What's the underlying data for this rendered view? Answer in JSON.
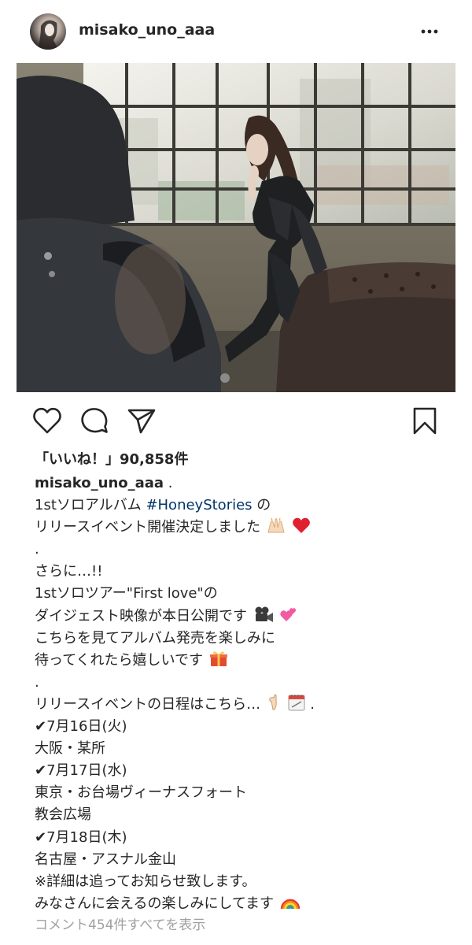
{
  "post": {
    "username": "misako_uno_aaa",
    "likes_text": "「いいね！」90,858件",
    "view_comments_text": "コメント454件すべてを表示"
  },
  "caption": {
    "username": "misako_uno_aaa",
    "username_suffix": " .",
    "line1_pre": "1stソロアルバム ",
    "hashtag": "#HoneyStories",
    "line1_post": " の",
    "line2": "リリースイベント開催決定しました",
    "dot1": ".",
    "line3": "さらに…!!",
    "line4": "1stソロツアー\"First love\"の",
    "line5": "ダイジェスト映像が本日公開です",
    "line6": "こちらを見てアルバム発売を楽しみに",
    "line7": "待ってくれたら嬉しいです",
    "dot2": ".",
    "line8": "リリースイベントの日程はこちら…",
    "line8_suffix": " .",
    "date1": "✔7月16日(火)",
    "venue1": "大阪・某所",
    "date2": "✔7月17日(水)",
    "venue2a": "東京・お台場ヴィーナスフォート",
    "venue2b": "教会広場",
    "date3": "✔7月18日(木)",
    "venue3": "名古屋・アスナル金山",
    "note": "※詳細は追ってお知らせ致します。",
    "closing": "みなさんに会えるの楽しみにしてます"
  },
  "icons": {
    "more": "more-options-icon",
    "like": "heart-icon",
    "comment": "comment-bubble-icon",
    "share": "paper-plane-icon",
    "save": "bookmark-icon"
  },
  "colors": {
    "text": "#262626",
    "hashtag": "#003569",
    "muted": "#a0a0a0",
    "heart": "#e0202e"
  }
}
